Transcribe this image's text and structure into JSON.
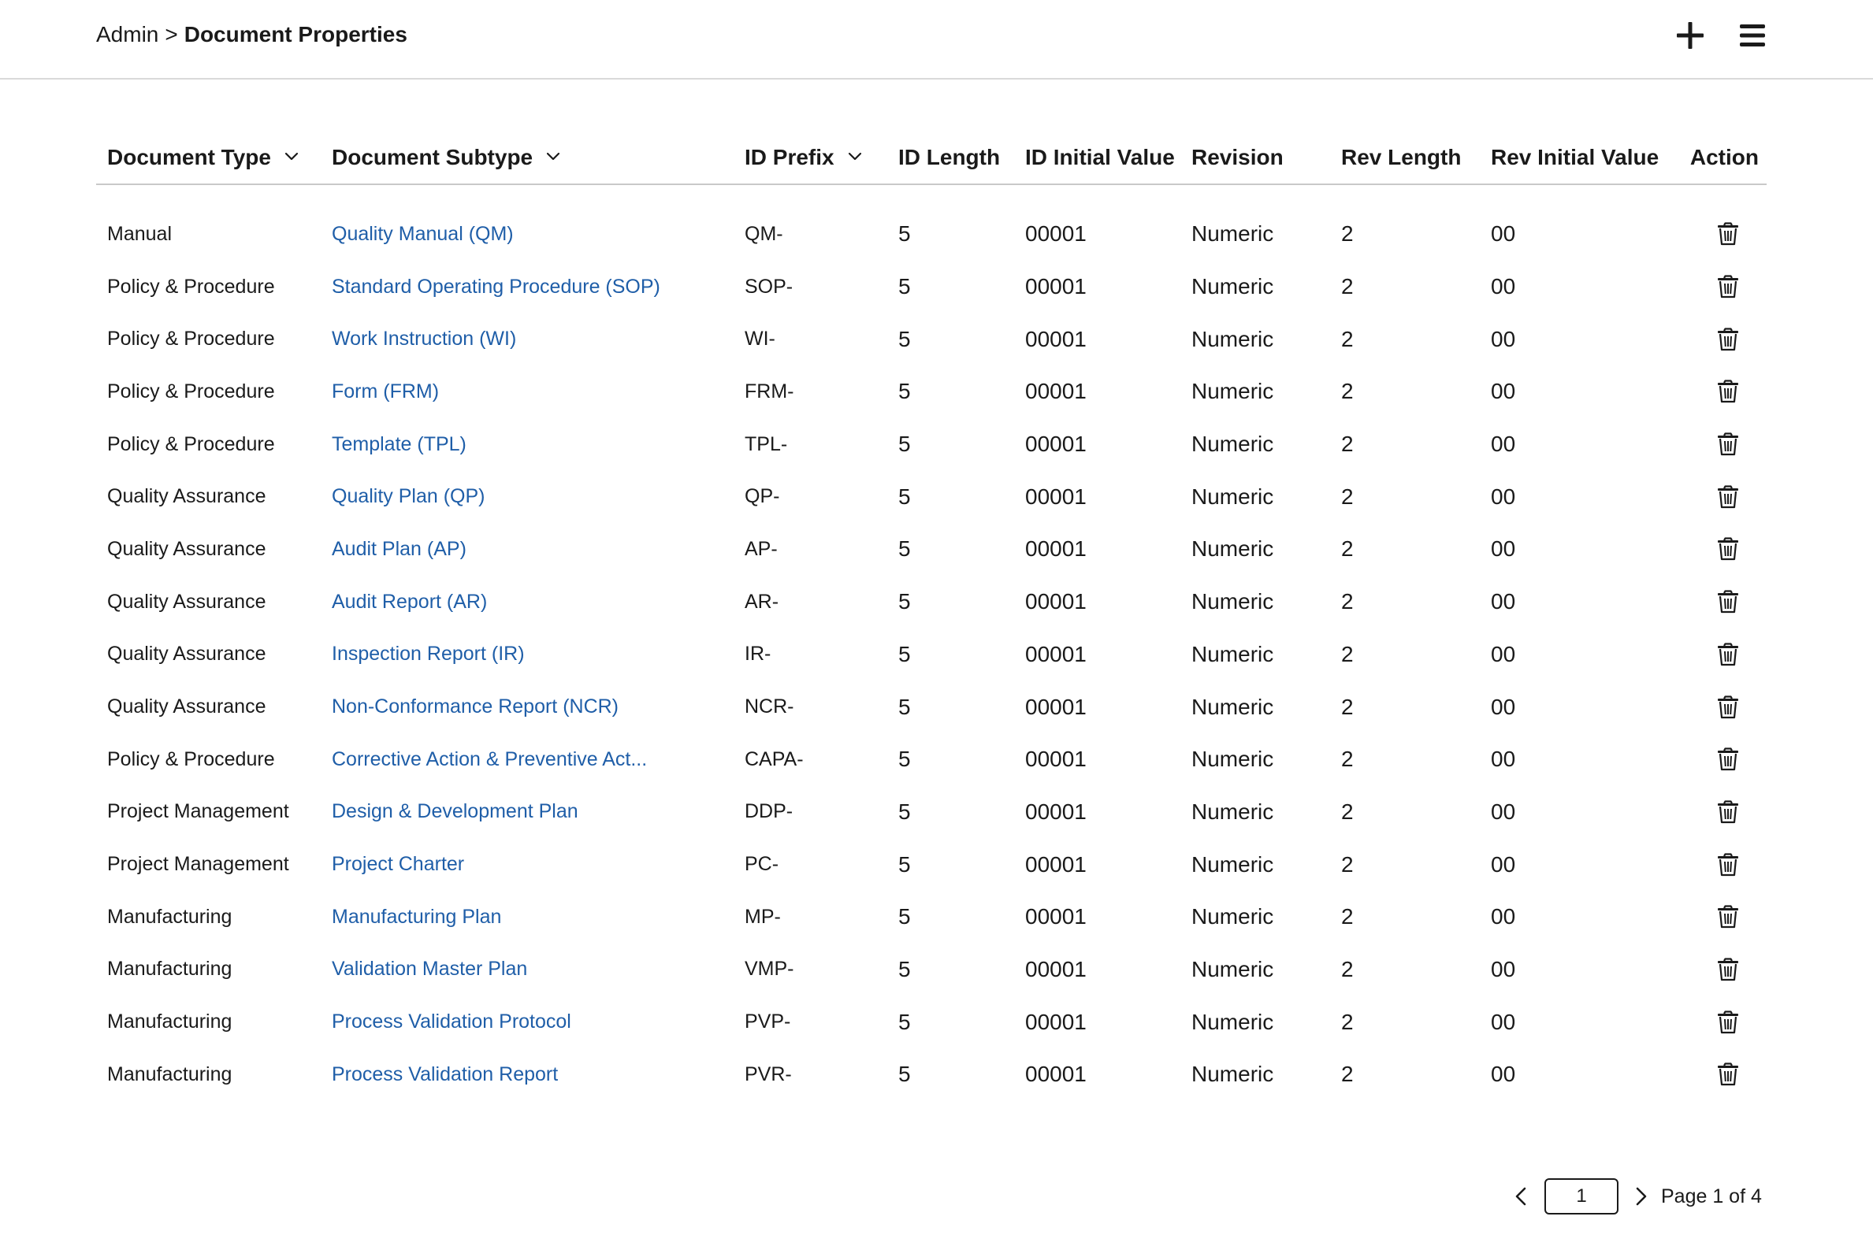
{
  "breadcrumb": {
    "root": "Admin",
    "separator": ">",
    "current": "Document Properties"
  },
  "header_icons": {
    "add": "plus-icon",
    "menu": "hamburger-menu-icon"
  },
  "table": {
    "columns": [
      {
        "key": "type",
        "label": "Document Type",
        "sortable": true
      },
      {
        "key": "subtype",
        "label": "Document Subtype",
        "sortable": true
      },
      {
        "key": "prefix",
        "label": "ID Prefix",
        "sortable": true
      },
      {
        "key": "length",
        "label": "ID Length",
        "sortable": false
      },
      {
        "key": "initial",
        "label": "ID Initial Value",
        "sortable": false
      },
      {
        "key": "revision",
        "label": "Revision",
        "sortable": false
      },
      {
        "key": "rev_length",
        "label": "Rev Length",
        "sortable": false
      },
      {
        "key": "rev_initial",
        "label": "Rev Initial Value",
        "sortable": false
      },
      {
        "key": "action",
        "label": "Action",
        "sortable": false
      }
    ],
    "rows": [
      {
        "type": "Manual",
        "subtype": "Quality Manual (QM)",
        "prefix": "QM-",
        "length": "5",
        "initial": "00001",
        "revision": "Numeric",
        "rev_length": "2",
        "rev_initial": "00"
      },
      {
        "type": "Policy & Procedure",
        "subtype": "Standard Operating Procedure (SOP)",
        "prefix": "SOP-",
        "length": "5",
        "initial": "00001",
        "revision": "Numeric",
        "rev_length": "2",
        "rev_initial": "00"
      },
      {
        "type": "Policy & Procedure",
        "subtype": "Work Instruction (WI)",
        "prefix": "WI-",
        "length": "5",
        "initial": "00001",
        "revision": "Numeric",
        "rev_length": "2",
        "rev_initial": "00"
      },
      {
        "type": "Policy & Procedure",
        "subtype": "Form (FRM)",
        "prefix": "FRM-",
        "length": "5",
        "initial": "00001",
        "revision": "Numeric",
        "rev_length": "2",
        "rev_initial": "00"
      },
      {
        "type": "Policy & Procedure",
        "subtype": "Template (TPL)",
        "prefix": "TPL-",
        "length": "5",
        "initial": "00001",
        "revision": "Numeric",
        "rev_length": "2",
        "rev_initial": "00"
      },
      {
        "type": "Quality Assurance",
        "subtype": "Quality Plan (QP)",
        "prefix": "QP-",
        "length": "5",
        "initial": "00001",
        "revision": "Numeric",
        "rev_length": "2",
        "rev_initial": "00"
      },
      {
        "type": "Quality Assurance",
        "subtype": "Audit Plan (AP)",
        "prefix": "AP-",
        "length": "5",
        "initial": "00001",
        "revision": "Numeric",
        "rev_length": "2",
        "rev_initial": "00"
      },
      {
        "type": "Quality Assurance",
        "subtype": "Audit Report (AR)",
        "prefix": "AR-",
        "length": "5",
        "initial": "00001",
        "revision": "Numeric",
        "rev_length": "2",
        "rev_initial": "00"
      },
      {
        "type": "Quality Assurance",
        "subtype": "Inspection Report (IR)",
        "prefix": "IR-",
        "length": "5",
        "initial": "00001",
        "revision": "Numeric",
        "rev_length": "2",
        "rev_initial": "00"
      },
      {
        "type": "Quality Assurance",
        "subtype": "Non-Conformance Report (NCR)",
        "prefix": "NCR-",
        "length": "5",
        "initial": "00001",
        "revision": "Numeric",
        "rev_length": "2",
        "rev_initial": "00"
      },
      {
        "type": "Policy & Procedure",
        "subtype": "Corrective Action & Preventive Act...",
        "prefix": "CAPA-",
        "length": "5",
        "initial": "00001",
        "revision": "Numeric",
        "rev_length": "2",
        "rev_initial": "00"
      },
      {
        "type": "Project Management",
        "subtype": "Design & Development Plan",
        "prefix": "DDP-",
        "length": "5",
        "initial": "00001",
        "revision": "Numeric",
        "rev_length": "2",
        "rev_initial": "00"
      },
      {
        "type": "Project Management",
        "subtype": "Project Charter",
        "prefix": "PC-",
        "length": "5",
        "initial": "00001",
        "revision": "Numeric",
        "rev_length": "2",
        "rev_initial": "00"
      },
      {
        "type": "Manufacturing",
        "subtype": "Manufacturing Plan",
        "prefix": "MP-",
        "length": "5",
        "initial": "00001",
        "revision": "Numeric",
        "rev_length": "2",
        "rev_initial": "00"
      },
      {
        "type": "Manufacturing",
        "subtype": "Validation Master Plan",
        "prefix": "VMP-",
        "length": "5",
        "initial": "00001",
        "revision": "Numeric",
        "rev_length": "2",
        "rev_initial": "00"
      },
      {
        "type": "Manufacturing",
        "subtype": "Process Validation Protocol",
        "prefix": "PVP-",
        "length": "5",
        "initial": "00001",
        "revision": "Numeric",
        "rev_length": "2",
        "rev_initial": "00"
      },
      {
        "type": "Manufacturing",
        "subtype": "Process Validation Report",
        "prefix": "PVR-",
        "length": "5",
        "initial": "00001",
        "revision": "Numeric",
        "rev_length": "2",
        "rev_initial": "00"
      }
    ],
    "row_action_icon": "trash-icon"
  },
  "pagination": {
    "current_page": "1",
    "info": "Page 1 of 4"
  },
  "colors": {
    "link": "#1f5ea8",
    "text": "#1a1a1a",
    "divider": "#c9c9c9"
  }
}
